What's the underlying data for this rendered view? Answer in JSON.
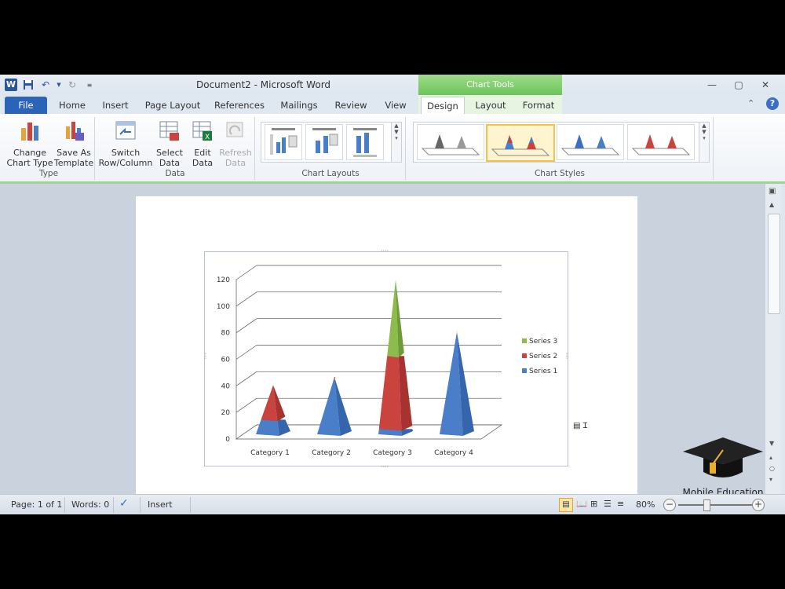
{
  "title_bar": {
    "document_title": "Document2 - Microsoft Word",
    "context_tab_group": "Chart Tools"
  },
  "tabs": [
    "File",
    "Home",
    "Insert",
    "Page Layout",
    "References",
    "Mailings",
    "Review",
    "View",
    "Design",
    "Layout",
    "Format"
  ],
  "active_tab": "Design",
  "ribbon": {
    "type_group": {
      "label": "Type",
      "change_chart_type": "Change Chart Type",
      "save_as_template": "Save As Template"
    },
    "data_group": {
      "label": "Data",
      "switch_row_column": "Switch Row/Column",
      "select_data": "Select Data",
      "edit_data": "Edit Data",
      "refresh_data": "Refresh Data"
    },
    "chart_layouts_group": {
      "label": "Chart Layouts"
    },
    "chart_styles_group": {
      "label": "Chart Styles"
    }
  },
  "status_bar": {
    "page": "Page: 1 of 1",
    "words": "Words: 0",
    "mode": "Insert",
    "zoom": "80%"
  },
  "watermark": "Mobile Education",
  "colors": {
    "series1": "#4a7ec9",
    "series2": "#c9433f",
    "series3": "#8dbb4d",
    "file_tab": "#2a63b8",
    "chart_tools": "#6cc45a"
  },
  "chart_data": {
    "type": "bar",
    "style": "3D pyramid, stacked",
    "categories": [
      "Category 1",
      "Category 2",
      "Category 3",
      "Category 4"
    ],
    "series": [
      {
        "name": "Series 1",
        "values": [
          11,
          41,
          4,
          75
        ]
      },
      {
        "name": "Series 2",
        "values": [
          26,
          2,
          55,
          1
        ]
      },
      {
        "name": "Series 3",
        "values": [
          0,
          0,
          57,
          1
        ]
      }
    ],
    "y_ticks": [
      "0",
      "20",
      "40",
      "60",
      "80",
      "100",
      "120"
    ],
    "ylim": [
      0,
      120
    ],
    "grid": true,
    "legend_position": "right"
  }
}
